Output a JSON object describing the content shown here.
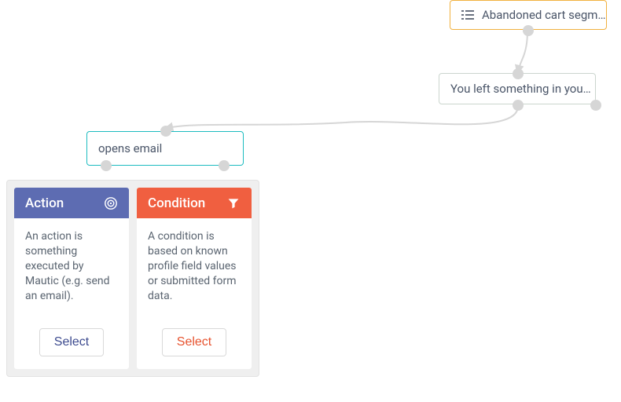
{
  "nodes": {
    "segment": {
      "label": "Abandoned cart segm…"
    },
    "email": {
      "label": "You left something in you…"
    },
    "decision": {
      "label": "opens email"
    }
  },
  "panel": {
    "action": {
      "title": "Action",
      "description": "An action is something executed by Mautic (e.g. send an email).",
      "select": "Select"
    },
    "condition": {
      "title": "Condition",
      "description": "A condition is based on known profile field values or submitted form data.",
      "select": "Select"
    }
  }
}
